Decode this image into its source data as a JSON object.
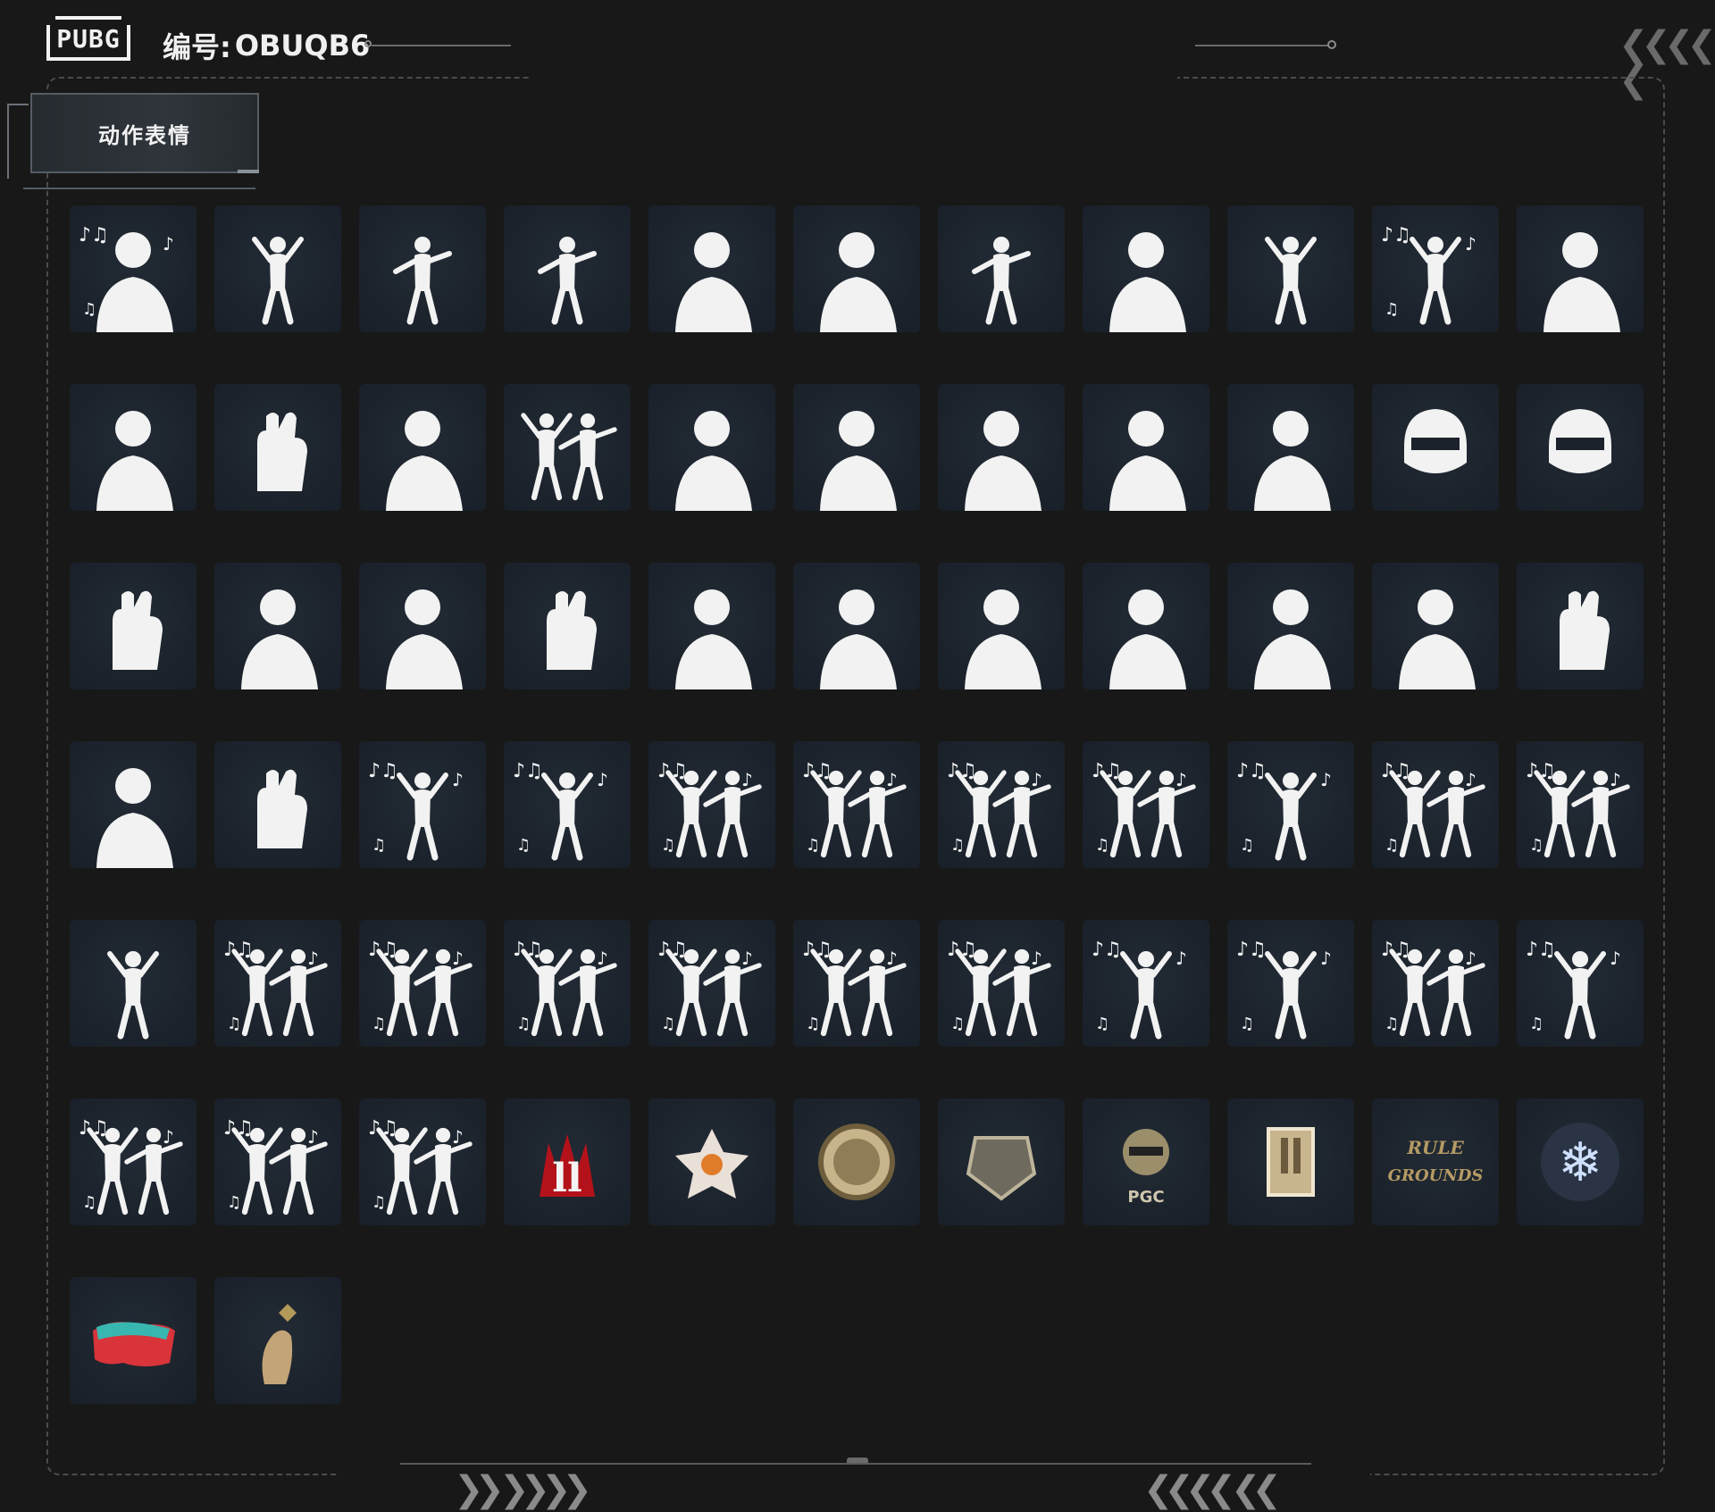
{
  "header": {
    "logo_text": "PUBG",
    "serial_label": "编号:",
    "serial_value": "OBUQB6",
    "chevrons": "❮❮❮❮ ❮"
  },
  "tab": {
    "label": "动作表情"
  },
  "footer": {
    "chevrons_left": "❯❯ ❯❯❯❯",
    "chevrons_right": "❮❮❮❮ ❮❮"
  },
  "grid": {
    "rows": 7,
    "columns": 11,
    "items": [
      {
        "icon": "emote-bow-icon",
        "notes": true
      },
      {
        "icon": "emote-jump-icon",
        "notes": false
      },
      {
        "icon": "emote-lean-icon",
        "notes": false
      },
      {
        "icon": "emote-graduate-icon",
        "notes": false
      },
      {
        "icon": "emote-hearts-icon",
        "notes": false
      },
      {
        "icon": "emote-money-icon",
        "notes": false
      },
      {
        "icon": "emote-flag-icon",
        "notes": false
      },
      {
        "icon": "emote-camera-icon",
        "notes": false
      },
      {
        "icon": "emote-confetti-icon",
        "notes": false
      },
      {
        "icon": "emote-rock-dance-icon",
        "notes": true
      },
      {
        "icon": "emote-facepalm-icon",
        "notes": false
      },
      {
        "icon": "emote-pray-icon",
        "notes": false
      },
      {
        "icon": "emote-heart-hands-icon",
        "notes": false
      },
      {
        "icon": "emote-think-icon",
        "notes": false
      },
      {
        "icon": "emote-duo-pose-icon",
        "notes": false
      },
      {
        "icon": "emote-blow-kiss-icon",
        "notes": false
      },
      {
        "icon": "emote-surrender-icon",
        "notes": false
      },
      {
        "icon": "emote-wave-icon",
        "notes": false
      },
      {
        "icon": "emote-headphones-icon",
        "notes": false
      },
      {
        "icon": "emote-sleep-icon",
        "notes": false
      },
      {
        "icon": "emote-angry-helmet-icon",
        "notes": false
      },
      {
        "icon": "emote-laugh-helmet-icon",
        "notes": false
      },
      {
        "icon": "emote-clap-icon",
        "notes": false
      },
      {
        "icon": "emote-pinch-nose-icon",
        "notes": false
      },
      {
        "icon": "emote-dizzy-icon",
        "notes": false
      },
      {
        "icon": "emote-point-icon",
        "notes": false
      },
      {
        "icon": "emote-salute-icon",
        "notes": false
      },
      {
        "icon": "emote-shrug-icon",
        "notes": false
      },
      {
        "icon": "emote-cry-icon",
        "notes": false
      },
      {
        "icon": "emote-stomp-icon",
        "notes": false
      },
      {
        "icon": "emote-shock-icon",
        "notes": false
      },
      {
        "icon": "emote-sad-icon",
        "notes": false
      },
      {
        "icon": "emote-stop-hand-icon",
        "notes": false
      },
      {
        "icon": "emote-arms-crossed-icon",
        "notes": false
      },
      {
        "icon": "emote-thumbs-up-icon",
        "notes": false
      },
      {
        "icon": "emote-dance-1-icon",
        "notes": true
      },
      {
        "icon": "emote-dance-kick-icon",
        "notes": true
      },
      {
        "icon": "emote-duo-dance-1-icon",
        "notes": true
      },
      {
        "icon": "emote-duo-dance-2-icon",
        "notes": true
      },
      {
        "icon": "emote-duo-dance-3-icon",
        "notes": true
      },
      {
        "icon": "emote-duo-dance-4-icon",
        "notes": true
      },
      {
        "icon": "emote-dance-2-icon",
        "notes": true
      },
      {
        "icon": "emote-duo-dance-5-icon",
        "notes": true
      },
      {
        "icon": "emote-duo-dance-6-icon",
        "notes": true
      },
      {
        "icon": "emote-star-jump-icon",
        "notes": false
      },
      {
        "icon": "emote-duo-dance-7-icon",
        "notes": true
      },
      {
        "icon": "emote-duo-dance-8-icon",
        "notes": true
      },
      {
        "icon": "emote-duo-dance-9-icon",
        "notes": true
      },
      {
        "icon": "emote-duo-dance-10-icon",
        "notes": true
      },
      {
        "icon": "emote-duo-dance-11-icon",
        "notes": true
      },
      {
        "icon": "emote-duo-dance-12-icon",
        "notes": true
      },
      {
        "icon": "emote-dance-3-icon",
        "notes": true
      },
      {
        "icon": "emote-dance-4-icon",
        "notes": true
      },
      {
        "icon": "emote-duo-dance-13-icon",
        "notes": true
      },
      {
        "icon": "emote-saxophone-icon",
        "notes": true
      },
      {
        "icon": "emote-duo-dance-14-icon",
        "notes": true
      },
      {
        "icon": "emote-duo-dance-15-icon",
        "notes": true
      },
      {
        "icon": "emote-duo-dance-16-icon",
        "notes": true
      },
      {
        "icon": "spray-flame-logo-icon",
        "notes": false
      },
      {
        "icon": "spray-star-creature-icon",
        "notes": false
      },
      {
        "icon": "spray-championship-coin-icon",
        "notes": false
      },
      {
        "icon": "spray-crest-logo-icon",
        "notes": false
      },
      {
        "icon": "spray-pgc-helmet-icon",
        "notes": false
      },
      {
        "icon": "spray-pgc-stamp-icon",
        "notes": false
      },
      {
        "icon": "spray-rule-the-grounds-icon",
        "notes": false
      },
      {
        "icon": "spray-snowflake-icon",
        "notes": false
      },
      {
        "icon": "spray-graffiti-icon",
        "notes": false
      },
      {
        "icon": "spray-finger-heart-icon",
        "notes": false
      }
    ]
  },
  "colors": {
    "background": "#181818",
    "tile": "#1c232c",
    "silhouette": "#f2f2f2",
    "frame": "#4b4b4b"
  }
}
